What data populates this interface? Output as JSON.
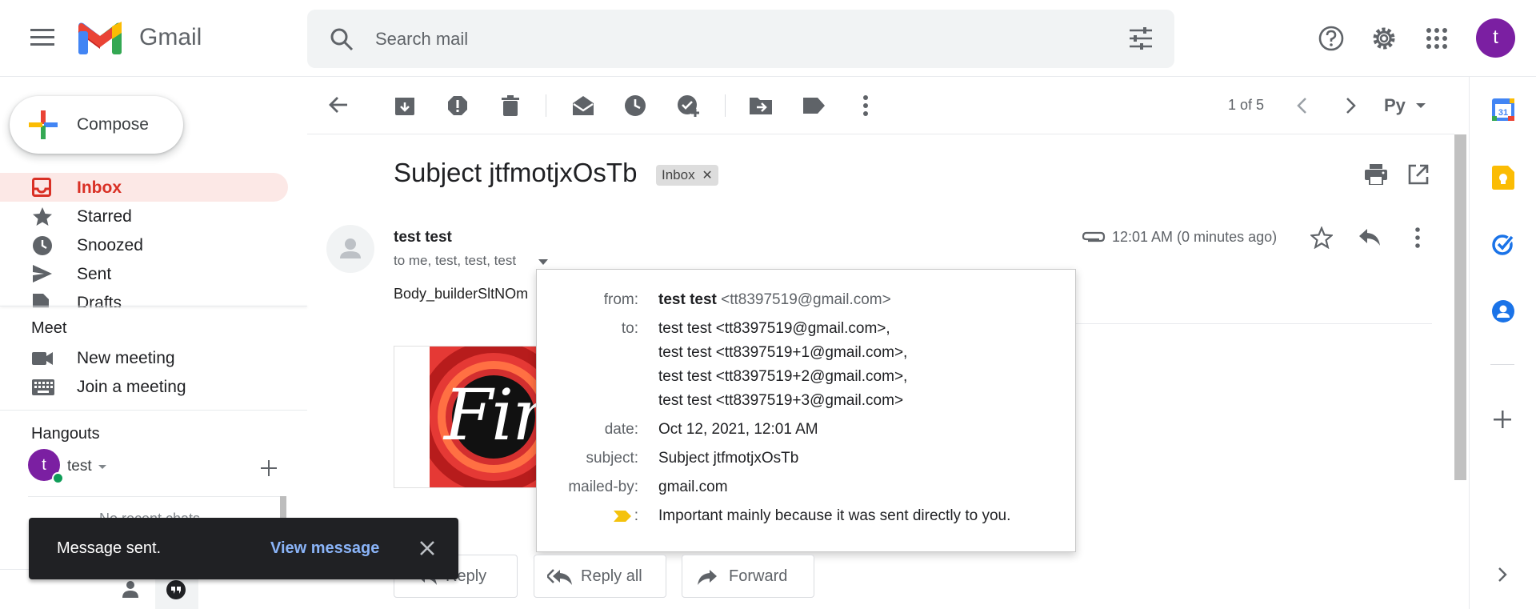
{
  "app": {
    "name": "Gmail",
    "account_initial": "t"
  },
  "search": {
    "placeholder": "Search mail"
  },
  "compose": {
    "label": "Compose"
  },
  "sidebar": {
    "items": [
      {
        "label": "Inbox",
        "icon": "inbox-icon",
        "active": true
      },
      {
        "label": "Starred",
        "icon": "star-icon"
      },
      {
        "label": "Snoozed",
        "icon": "clock-icon"
      },
      {
        "label": "Sent",
        "icon": "send-icon"
      },
      {
        "label": "Drafts",
        "icon": "draft-icon"
      }
    ]
  },
  "meet": {
    "title": "Meet",
    "new_meeting": "New meeting",
    "join_meeting": "Join a meeting"
  },
  "hangouts": {
    "title": "Hangouts",
    "user": "test",
    "user_initial": "t",
    "partial_text": "No recent chats"
  },
  "toolbar": {
    "pagination": "1 of 5",
    "input_tool": "Py"
  },
  "message": {
    "subject": "Subject jtfmotjxOsTb",
    "label_badge": "Inbox",
    "sender": "test test",
    "recipients_line": "to me, test, test, test",
    "body_preview": "Body_builderSltNOm",
    "time": "12:01 AM (0 minutes ago)",
    "image_text": "Fin"
  },
  "details_popup": {
    "from_label": "from:",
    "from_name": "test test",
    "from_email": "<tt8397519@gmail.com>",
    "to_label": "to:",
    "to_list": [
      "test test <tt8397519@gmail.com>,",
      "test test <tt8397519+1@gmail.com>,",
      "test test <tt8397519+2@gmail.com>,",
      "test test <tt8397519+3@gmail.com>"
    ],
    "date_label": "date:",
    "date": "Oct 12, 2021, 12:01 AM",
    "subject_label": "subject:",
    "subject": "Subject jtfmotjxOsTb",
    "mailed_by_label": "mailed-by:",
    "mailed_by": "gmail.com",
    "important_label": ":",
    "important": "Important mainly because it was sent directly to you."
  },
  "actions": {
    "reply": "Reply",
    "reply_all": "Reply all",
    "forward": "Forward"
  },
  "snackbar": {
    "message": "Message sent.",
    "link": "View message"
  },
  "colors": {
    "accent_red": "#d93025",
    "active_bg": "#fce8e6",
    "avatar": "#7b1fa2",
    "snackbar_bg": "#202124",
    "link_blue": "#8ab4f8"
  }
}
